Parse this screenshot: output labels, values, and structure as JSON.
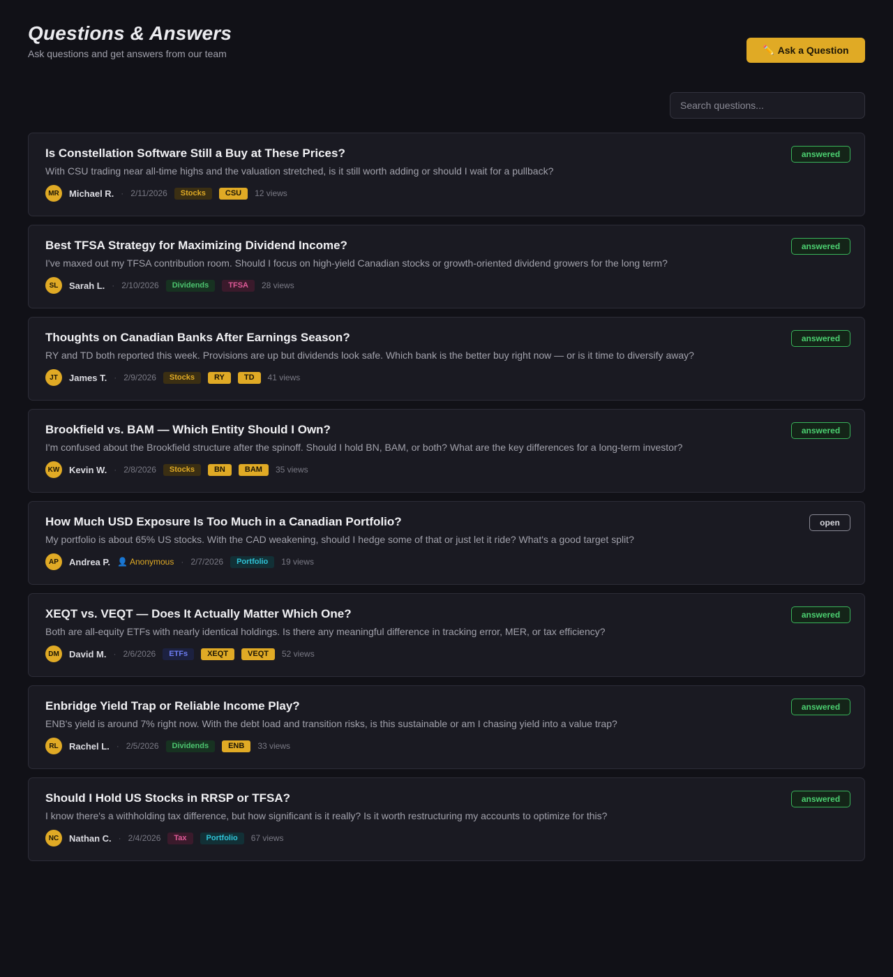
{
  "header": {
    "title": "Questions & Answers",
    "subtitle": "Ask questions and get answers from our team",
    "ask_label": "Ask a Question",
    "ask_icon": "pencil-icon"
  },
  "search": {
    "placeholder": "Search questions...",
    "value": ""
  },
  "questions": [
    {
      "title": "Is Constellation Software Still a Buy at These Prices?",
      "body": "With CSU trading near all-time highs and the valuation stretched, is it still worth adding or should I wait for a pullback?",
      "initials": "MR",
      "author": "Michael R.",
      "anonymous": "",
      "date": "2/11/2026",
      "tags": [
        {
          "label": "Stocks",
          "kind": "stocks"
        },
        {
          "label": "CSU",
          "kind": "ticker"
        }
      ],
      "views": "12 views",
      "status": "answered"
    },
    {
      "title": "Best TFSA Strategy for Maximizing Dividend Income?",
      "body": "I've maxed out my TFSA contribution room. Should I focus on high-yield Canadian stocks or growth-oriented dividend growers for the long term?",
      "initials": "SL",
      "author": "Sarah L.",
      "anonymous": "",
      "date": "2/10/2026",
      "tags": [
        {
          "label": "Dividends",
          "kind": "dividends"
        },
        {
          "label": "TFSA",
          "kind": "tfsa"
        }
      ],
      "views": "28 views",
      "status": "answered"
    },
    {
      "title": "Thoughts on Canadian Banks After Earnings Season?",
      "body": "RY and TD both reported this week. Provisions are up but dividends look safe. Which bank is the better buy right now — or is it time to diversify away?",
      "initials": "JT",
      "author": "James T.",
      "anonymous": "",
      "date": "2/9/2026",
      "tags": [
        {
          "label": "Stocks",
          "kind": "stocks"
        },
        {
          "label": "RY",
          "kind": "ticker"
        },
        {
          "label": "TD",
          "kind": "ticker"
        }
      ],
      "views": "41 views",
      "status": "answered"
    },
    {
      "title": "Brookfield vs. BAM — Which Entity Should I Own?",
      "body": "I'm confused about the Brookfield structure after the spinoff. Should I hold BN, BAM, or both? What are the key differences for a long-term investor?",
      "initials": "KW",
      "author": "Kevin W.",
      "anonymous": "",
      "date": "2/8/2026",
      "tags": [
        {
          "label": "Stocks",
          "kind": "stocks"
        },
        {
          "label": "BN",
          "kind": "ticker"
        },
        {
          "label": "BAM",
          "kind": "ticker"
        }
      ],
      "views": "35 views",
      "status": "answered"
    },
    {
      "title": "How Much USD Exposure Is Too Much in a Canadian Portfolio?",
      "body": "My portfolio is about 65% US stocks. With the CAD weakening, should I hedge some of that or just let it ride? What's a good target split?",
      "initials": "AP",
      "author": "Andrea P.",
      "anonymous": "Anonymous",
      "date": "2/7/2026",
      "tags": [
        {
          "label": "Portfolio",
          "kind": "portfolio"
        }
      ],
      "views": "19 views",
      "status": "open"
    },
    {
      "title": "XEQT vs. VEQT — Does It Actually Matter Which One?",
      "body": "Both are all-equity ETFs with nearly identical holdings. Is there any meaningful difference in tracking error, MER, or tax efficiency?",
      "initials": "DM",
      "author": "David M.",
      "anonymous": "",
      "date": "2/6/2026",
      "tags": [
        {
          "label": "ETFs",
          "kind": "etfs"
        },
        {
          "label": "XEQT",
          "kind": "ticker"
        },
        {
          "label": "VEQT",
          "kind": "ticker"
        }
      ],
      "views": "52 views",
      "status": "answered"
    },
    {
      "title": "Enbridge Yield Trap or Reliable Income Play?",
      "body": "ENB's yield is around 7% right now. With the debt load and transition risks, is this sustainable or am I chasing yield into a value trap?",
      "initials": "RL",
      "author": "Rachel L.",
      "anonymous": "",
      "date": "2/5/2026",
      "tags": [
        {
          "label": "Dividends",
          "kind": "dividends"
        },
        {
          "label": "ENB",
          "kind": "ticker"
        }
      ],
      "views": "33 views",
      "status": "answered"
    },
    {
      "title": "Should I Hold US Stocks in RRSP or TFSA?",
      "body": "I know there's a withholding tax difference, but how significant is it really? Is it worth restructuring my accounts to optimize for this?",
      "initials": "NC",
      "author": "Nathan C.",
      "anonymous": "",
      "date": "2/4/2026",
      "tags": [
        {
          "label": "Tax",
          "kind": "tax"
        },
        {
          "label": "Portfolio",
          "kind": "portfolio"
        }
      ],
      "views": "67 views",
      "status": "answered"
    }
  ],
  "colors": {
    "accent": "#e0aa25",
    "background": "#111117",
    "card": "#1a1a22",
    "answered": "#4cd171"
  }
}
